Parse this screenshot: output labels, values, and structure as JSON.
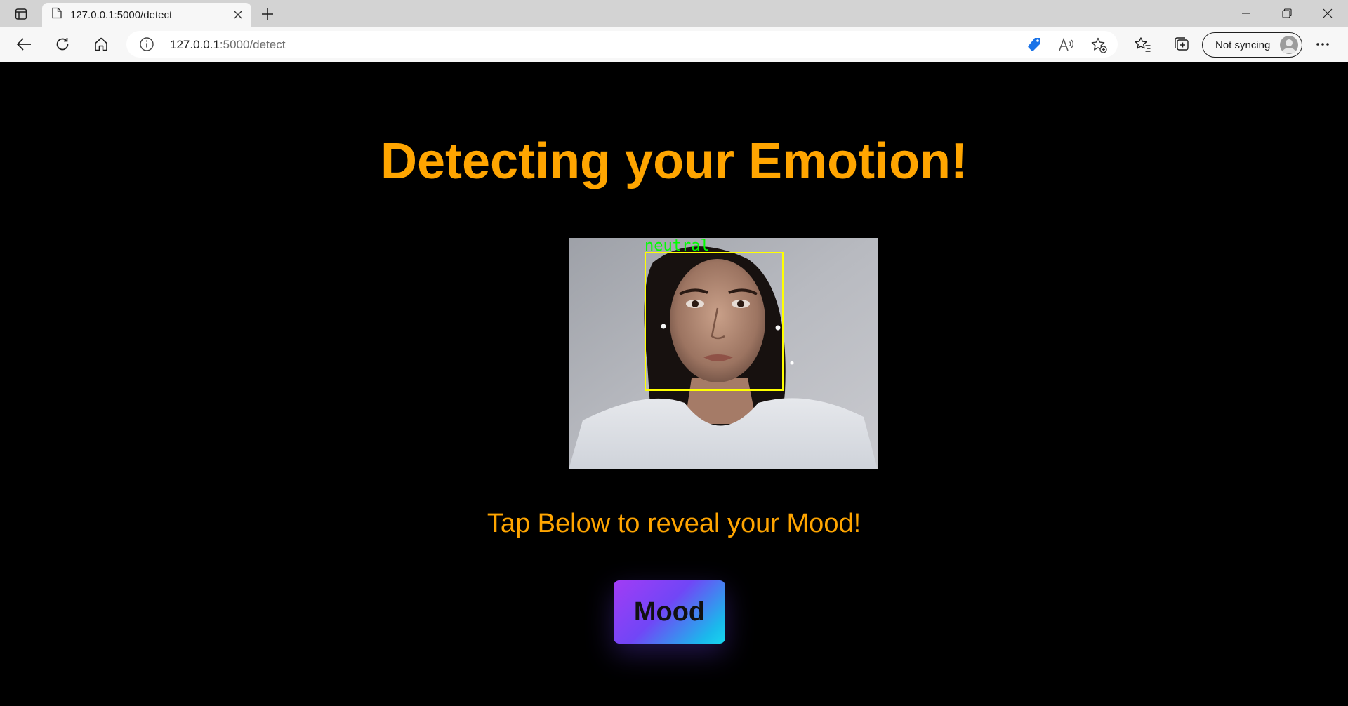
{
  "browser": {
    "tab_title": "127.0.0.1:5000/detect",
    "url_host": "127.0.0.1",
    "url_rest": ":5000/detect",
    "profile_label": "Not syncing"
  },
  "icons": {
    "tab_actions": "tab-actions-icon",
    "page": "page-icon",
    "close": "close-icon",
    "new_tab": "plus-icon",
    "minimize": "minimize-icon",
    "restore": "restore-icon",
    "back": "back-arrow-icon",
    "refresh": "refresh-icon",
    "home": "home-icon",
    "site_info": "info-icon",
    "shopping": "price-tag-icon",
    "read_aloud": "read-aloud-icon",
    "add_favorite": "star-add-icon",
    "favorites": "favorites-icon",
    "collections": "collections-icon",
    "more": "more-icon"
  },
  "page": {
    "title": "Detecting your Emotion!",
    "detection_label": "neutral",
    "subtitle": "Tap Below to reveal your Mood!",
    "button_label": "Mood"
  },
  "colors": {
    "accent_text": "#ffa500",
    "detection_box": "#ffff00",
    "detection_label": "#00ff00",
    "button_gradient_start": "#a23cf5",
    "button_gradient_end": "#17d6ee",
    "background": "#000000"
  }
}
